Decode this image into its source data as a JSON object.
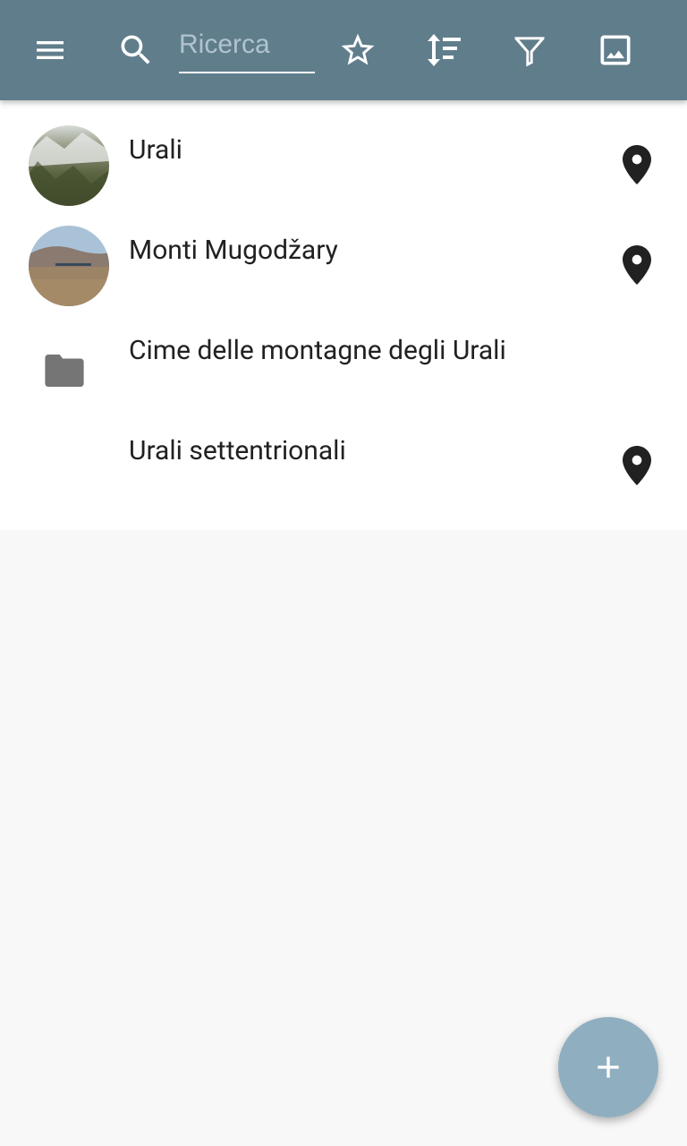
{
  "toolbar": {
    "search_placeholder": "Ricerca",
    "icons": [
      "menu-icon",
      "search-icon",
      "star-outline-icon",
      "sort-icon",
      "filter-icon",
      "image-icon"
    ],
    "background_color": "#607d8b"
  },
  "items": [
    {
      "label": "Urali",
      "kind": "place",
      "thumbnail": "snowy-mountain-photo",
      "has_pin": true
    },
    {
      "label": "Monti Mugodžary",
      "kind": "place",
      "thumbnail": "steppe-hills-photo",
      "has_pin": true
    },
    {
      "label": "Cime delle montagne degli Urali",
      "kind": "folder",
      "has_pin": false
    },
    {
      "label": "Urali settentrionali",
      "kind": "place",
      "has_pin": true
    }
  ],
  "fab": {
    "icon": "plus-icon",
    "color": "#8fafc0"
  }
}
